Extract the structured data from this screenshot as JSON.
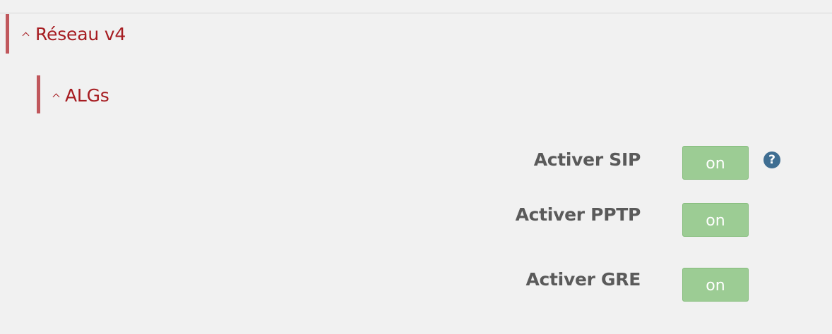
{
  "sections": [
    {
      "title": "Réseau v4",
      "expanded": true,
      "icon": "chevron-up-icon"
    },
    {
      "title": "ALGs",
      "expanded": true,
      "icon": "chevron-up-icon"
    }
  ],
  "settings": [
    {
      "label": "Activer SIP",
      "toggle": "on",
      "has_help": true
    },
    {
      "label": "Activer PPTP",
      "toggle": "on",
      "has_help": false
    },
    {
      "label": "Activer GRE",
      "toggle": "on",
      "has_help": false
    }
  ],
  "help_icon": {
    "glyph": "?",
    "icon": "help-icon"
  },
  "colors": {
    "section_title": "#a61c21",
    "section_bar": "#c0575c",
    "toggle_on_bg": "#9ccc94",
    "label_text": "#5a5a5a",
    "help_icon_bg": "#3f6e92",
    "background": "#f1f1f1"
  }
}
